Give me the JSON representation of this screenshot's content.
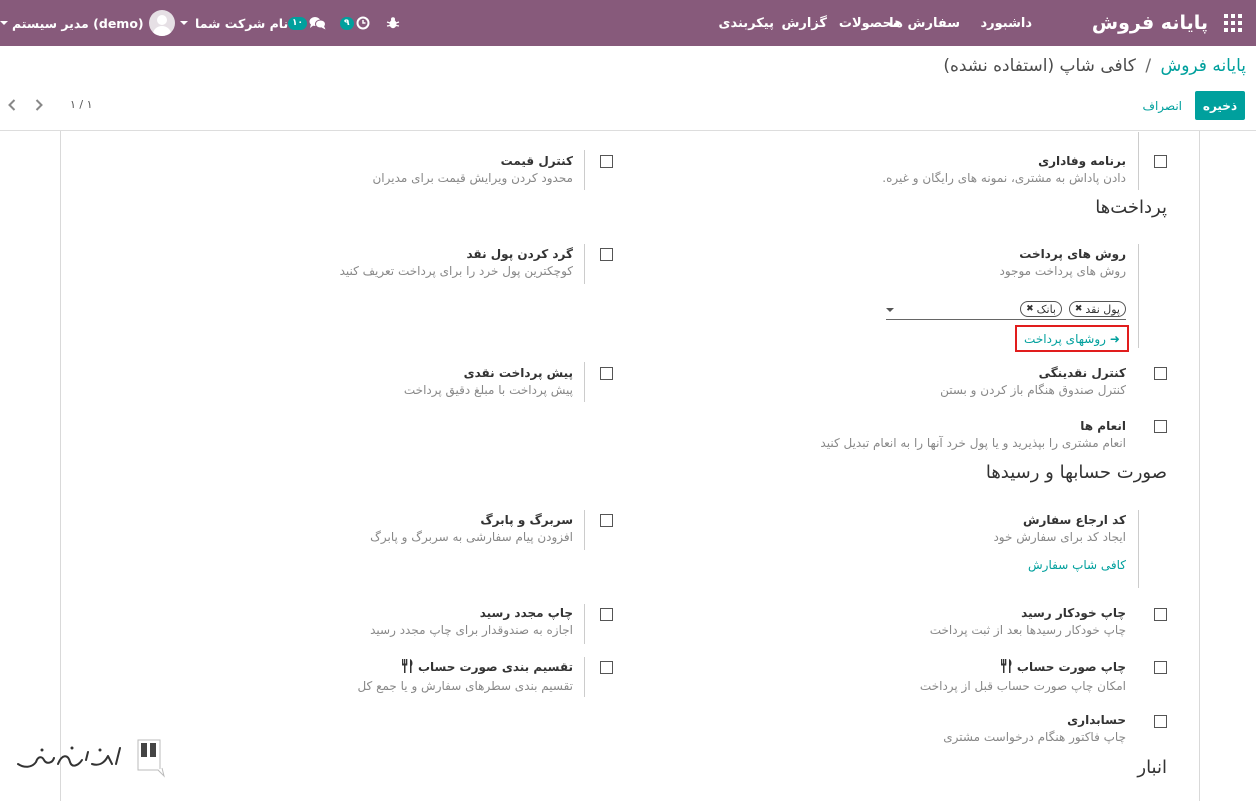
{
  "navbar": {
    "brand": "پایانه فروش",
    "menu": [
      "داشبورد",
      "سفارش ها",
      "محصولات",
      "گزارش",
      "پیکربندی"
    ],
    "activity_count": "۹",
    "message_count": "۱۰",
    "company": "نام شرکت شما",
    "user": "مدیر سیستم (demo)"
  },
  "breadcrumb": {
    "parent": "پایانه فروش",
    "separator": "/",
    "current": "کافی شاپ (استفاده نشده)"
  },
  "buttons": {
    "save": "ذخیره",
    "discard": "انصراف"
  },
  "pager": {
    "value": "۱ / ۱"
  },
  "settings": {
    "loyalty": {
      "title": "برنامه وفاداری",
      "desc": "دادن پاداش به مشتری، نمونه های رایگان و غیره."
    },
    "price_control": {
      "title": "کنترل قیمت",
      "desc": "محدود کردن ویرایش قیمت برای مدیران"
    },
    "payment_methods": {
      "title": "روش های پرداخت",
      "desc": "روش های پرداخت موجود",
      "tags": [
        "پول نقد",
        "بانک"
      ],
      "link": "روشهای پرداخت"
    },
    "cash_rounding": {
      "title": "گرد کردن پول نقد",
      "desc": "کوچکترین پول خرد را برای پرداخت تعریف کنید"
    },
    "cash_control": {
      "title": "کنترل نقدینگی",
      "desc": "کنترل صندوق هنگام باز کردن و بستن"
    },
    "prefill_cash": {
      "title": "پیش پرداخت نقدی",
      "desc": "پیش پرداخت با مبلغ دقیق پرداخت"
    },
    "tips": {
      "title": "انعام ها",
      "desc": "انعام مشتری را بپذیرید و یا پول خرد آنها را به انعام تبدیل کنید"
    },
    "order_reference": {
      "title": "کد ارجاع سفارش",
      "desc": "ایجاد کد برای سفارش خود",
      "link": "کافی شاپ سفارش"
    },
    "header_footer": {
      "title": "سربرگ و پابرگ",
      "desc": "افزودن پیام سفارشی به سربرگ و پابرگ"
    },
    "auto_print": {
      "title": "چاپ خودکار رسید",
      "desc": "چاپ خودکار رسیدها بعد از ثبت پرداخت"
    },
    "reprint": {
      "title": "چاپ مجدد رسید",
      "desc": "اجازه به صندوقدار برای چاپ مجدد رسید"
    },
    "bill_print": {
      "title": "چاپ صورت حساب",
      "desc": "امکان چاپ صورت حساب قبل از پرداخت"
    },
    "bill_split": {
      "title": "تقسیم بندی صورت حساب",
      "desc": "تقسیم بندی سطرهای سفارش و یا جمع کل"
    },
    "invoicing": {
      "title": "حسابداری",
      "desc": "چاپ فاکتور هنگام درخواست مشتری"
    }
  },
  "sections": {
    "payments": "پرداخت‌ها",
    "bills": "صورت حسابها و رسیدها",
    "inventory": "انبار"
  },
  "colors": {
    "navbar": "#875a7b",
    "accent": "#00a09d",
    "highlight": "#e11d1d"
  }
}
